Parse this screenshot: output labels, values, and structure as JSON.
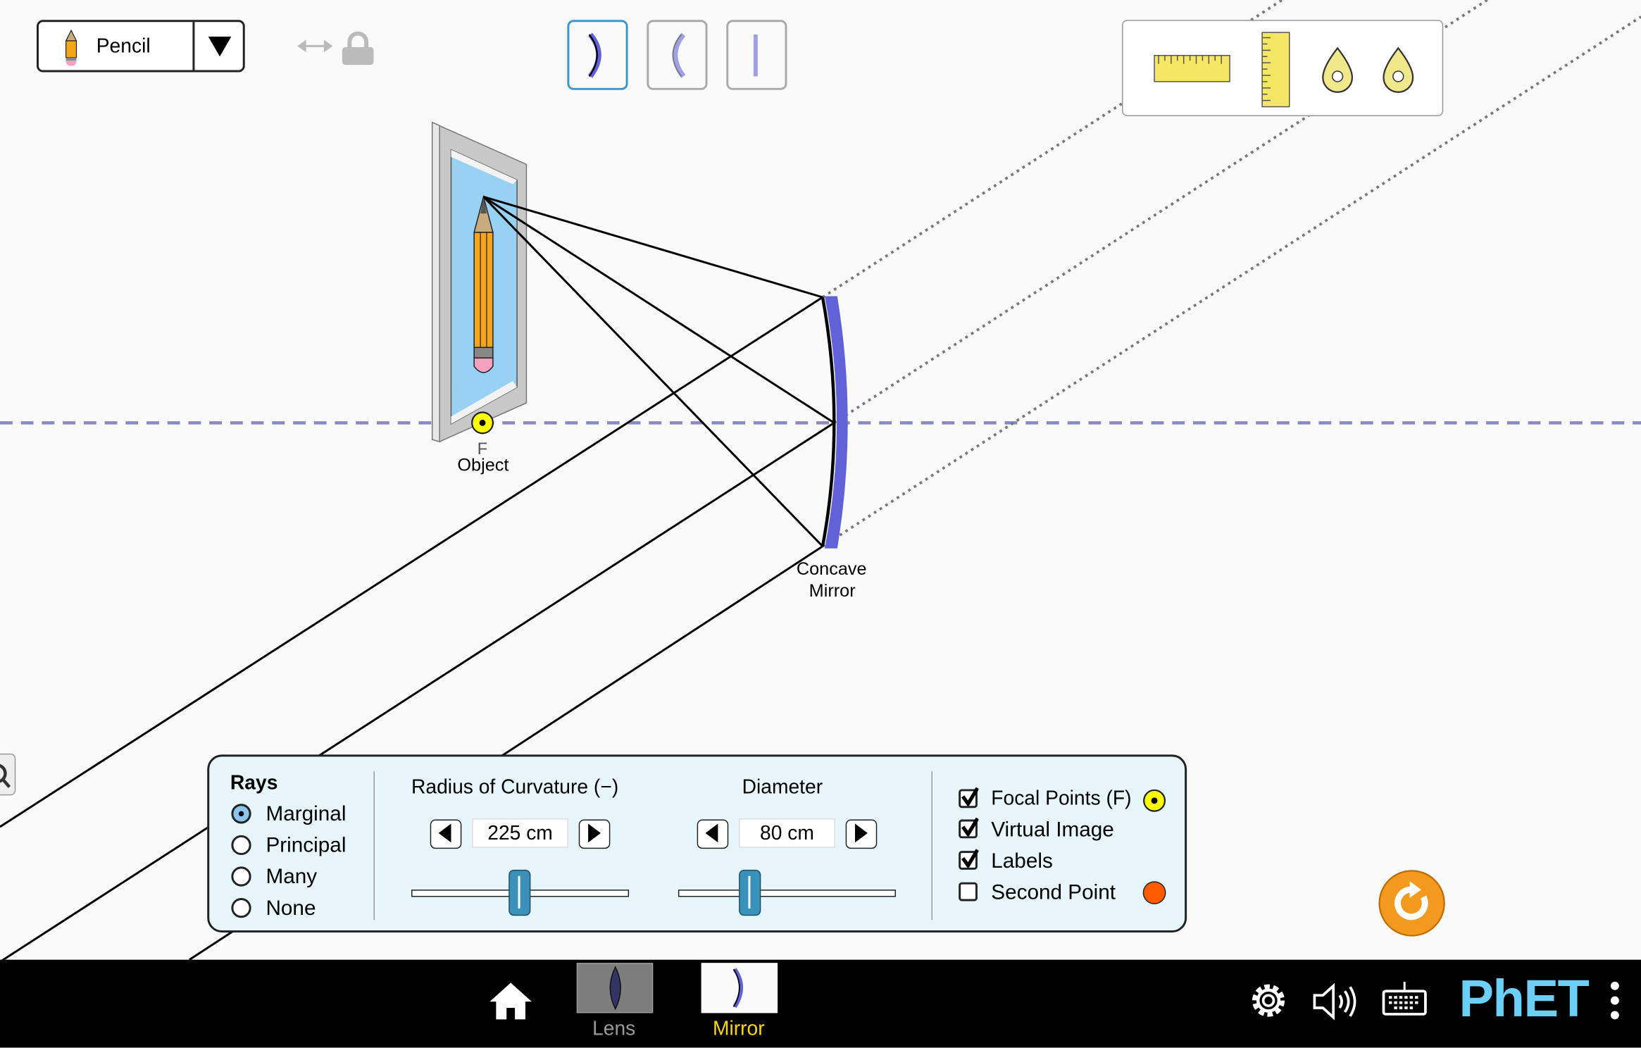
{
  "object_selector": {
    "selected": "Pencil",
    "icon": "pencil-icon"
  },
  "lock_controls": {
    "icons": [
      "horizontal-arrow-icon",
      "lock-icon"
    ]
  },
  "mirror_types": [
    {
      "name": "concave",
      "selected": true
    },
    {
      "name": "convex",
      "selected": false
    },
    {
      "name": "flat",
      "selected": false
    }
  ],
  "toolbox": {
    "items": [
      "horizontal-ruler-icon",
      "vertical-ruler-icon",
      "intensity-probe-icon",
      "position-probe-icon"
    ]
  },
  "scene": {
    "focal_label": "F",
    "object_label": "Object",
    "mirror_label_line1": "Concave",
    "mirror_label_line2": "Mirror",
    "colors": {
      "mirror": "#6262d8",
      "axis": "#8a88c0",
      "focal_point": "#ffff00",
      "screen_bg": "#97d1f4"
    }
  },
  "controls": {
    "rays": {
      "title": "Rays",
      "options": [
        "Marginal",
        "Principal",
        "Many",
        "None"
      ],
      "selected": "Marginal"
    },
    "radius": {
      "title": "Radius of Curvature (−)",
      "value": "225 cm",
      "slider_fraction": 0.5
    },
    "diameter": {
      "title": "Diameter",
      "value": "80 cm",
      "slider_fraction": 0.33
    },
    "checkboxes": [
      {
        "label": "Focal Points (F)",
        "checked": true
      },
      {
        "label": "Virtual Image",
        "checked": true
      },
      {
        "label": "Labels",
        "checked": true
      },
      {
        "label": "Second Point",
        "checked": false
      }
    ],
    "colors": {
      "panel_bg": "#e6f6fa",
      "second_point": "#ff5b00",
      "slider_thumb": "#3a92ba"
    }
  },
  "reset_button": {
    "icon": "reset-icon",
    "color": "#f39a1e"
  },
  "navbar": {
    "screens": [
      {
        "label": "Lens",
        "selected": false
      },
      {
        "label": "Mirror",
        "selected": true
      }
    ],
    "brand": "PhET",
    "icons": [
      "home-icon",
      "settings-icon",
      "sound-icon",
      "keyboard-icon",
      "menu-icon"
    ]
  }
}
